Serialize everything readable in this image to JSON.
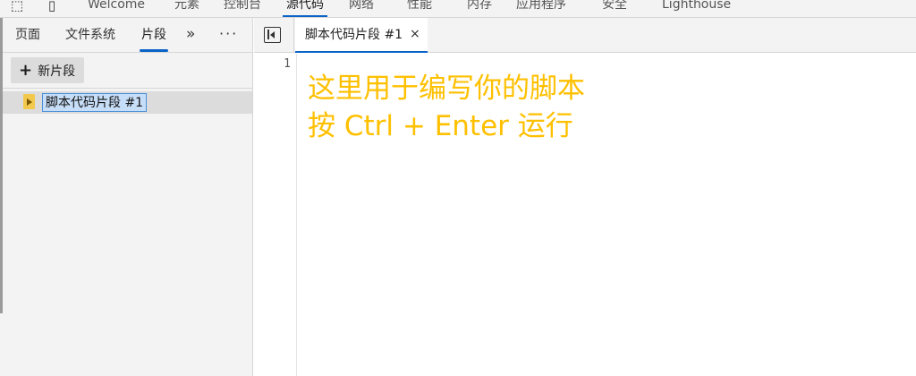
{
  "top_tabs": [
    "Welcome",
    "元素",
    "控制台",
    "源代码",
    "网络",
    "性能",
    "内存",
    "应用程序",
    "安全",
    "Lighthouse"
  ],
  "top_active_index": 3,
  "navigator": {
    "tabs": [
      "页面",
      "文件系统",
      "片段"
    ],
    "active_index": 2,
    "more_tabs_icon": "»",
    "menu_icon": "⋮",
    "new_snippet_label": "新片段",
    "snippets": [
      {
        "name": "脚本代码片段 #1"
      }
    ]
  },
  "editor": {
    "tab_label": "脚本代码片段 #1",
    "close_icon": "×",
    "line_number": "1",
    "lines": [
      "这里用于编写你的脚本",
      "按 Ctrl + Enter 运行"
    ]
  },
  "colors": {
    "accent": "#0a64c8",
    "placeholder_text": "#ffc000",
    "snippet_icon": "#f2c94c"
  }
}
